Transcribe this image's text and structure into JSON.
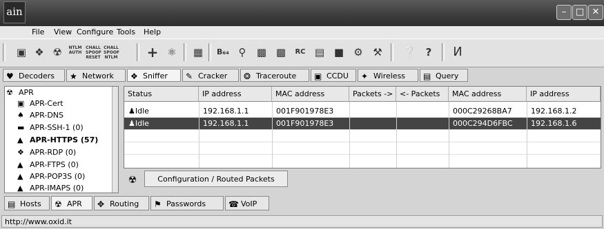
{
  "window": {
    "app_icon_text": "ain",
    "minimize": "–",
    "maximize": "□",
    "close": "✕"
  },
  "menu": [
    "File",
    "View",
    "Configure",
    "Tools",
    "Help"
  ],
  "toolbar": {
    "icons": [
      "open-icon",
      "tools-icon",
      "radiation-icon",
      "ntlm-auth-icon",
      "chall-spoof-reset-icon",
      "chall-spoof-ntlm-icon",
      "add-icon",
      "certificate-icon",
      "routing-icon",
      "base64-icon",
      "map-icon",
      "hash-icon",
      "console-icon",
      "rc-icon",
      "monitor-icon",
      "network-card-icon",
      "gear-icon",
      "tools-wrench-icon",
      "info-icon",
      "help-icon",
      "pillar-icon"
    ],
    "small_labels": {
      "ntlm_auth": "NTLM AUTH",
      "chall_spoof_reset": "CHALL SPOOF RESET",
      "chall_spoof_ntlm": "CHALL SPOOF NTLM"
    }
  },
  "tabs": [
    {
      "label": "Decoders",
      "icon": "decoders-icon"
    },
    {
      "label": "Network",
      "icon": "network-icon"
    },
    {
      "label": "Sniffer",
      "icon": "sniffer-icon",
      "active": true
    },
    {
      "label": "Cracker",
      "icon": "cracker-icon"
    },
    {
      "label": "Traceroute",
      "icon": "traceroute-icon"
    },
    {
      "label": "CCDU",
      "icon": "ccdu-icon"
    },
    {
      "label": "Wireless",
      "icon": "wireless-icon"
    },
    {
      "label": "Query",
      "icon": "query-icon"
    }
  ],
  "tree": [
    {
      "label": "APR",
      "bold": false
    },
    {
      "label": "APR-Cert",
      "bold": false
    },
    {
      "label": "APR-DNS",
      "bold": false
    },
    {
      "label": "APR-SSH-1 (0)",
      "bold": false
    },
    {
      "label": "APR-HTTPS (57)",
      "bold": true
    },
    {
      "label": "APR-RDP (0)",
      "bold": false
    },
    {
      "label": "APR-FTPS (0)",
      "bold": false
    },
    {
      "label": "APR-POP3S (0)",
      "bold": false
    },
    {
      "label": "APR-IMAPS (0)",
      "bold": false
    }
  ],
  "table": {
    "columns": [
      "Status",
      "IP address",
      "MAC address",
      "Packets ->",
      "<- Packets",
      "MAC address",
      "IP address"
    ],
    "rows": [
      [
        "Idle",
        "192.168.1.1",
        "001F901978E3",
        "",
        "",
        "000C29268BA7",
        "192.168.1.2"
      ],
      [
        "Idle",
        "192.168.1.1",
        "001F901978E3",
        "",
        "",
        "000C294D6FBC",
        "192.168.1.6"
      ]
    ],
    "selected_row": 1
  },
  "subtab": {
    "label": "Configuration / Routed Packets"
  },
  "bottom_tabs": [
    {
      "label": "Hosts",
      "icon": "hosts-icon"
    },
    {
      "label": "APR",
      "icon": "apr-icon",
      "active": true
    },
    {
      "label": "Routing",
      "icon": "routing-icon"
    },
    {
      "label": "Passwords",
      "icon": "passwords-icon"
    },
    {
      "label": "VoIP",
      "icon": "voip-icon"
    }
  ],
  "status_bar": {
    "url": "http://www.oxid.it"
  }
}
